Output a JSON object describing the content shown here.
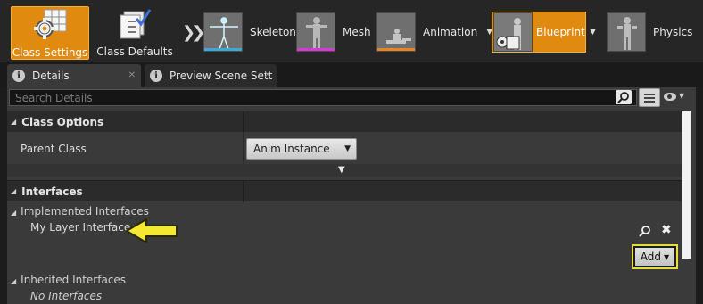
{
  "toolbar": {
    "class_settings_label": "Class Settings",
    "class_defaults_label": "Class Defaults",
    "modes": [
      {
        "label": "Skeleton",
        "accent": "#3fa8d9"
      },
      {
        "label": "Mesh",
        "accent": "#d63ad6"
      },
      {
        "label": "Animation",
        "accent": "#e6842a"
      },
      {
        "label": "Blueprint",
        "accent": "#e08b10"
      },
      {
        "label": "Physics",
        "accent": "#e6d23a"
      }
    ],
    "active_color": "#e08b10"
  },
  "tabs": [
    {
      "label": "Details",
      "icon": "info-icon",
      "active": true
    },
    {
      "label": "Preview Scene Sett",
      "icon": "info-icon",
      "active": false
    }
  ],
  "search": {
    "placeholder": "Search Details"
  },
  "class_options": {
    "title": "Class Options",
    "parent_class_label": "Parent Class",
    "parent_class_value": "Anim Instance"
  },
  "interfaces": {
    "title": "Interfaces",
    "implemented_label": "Implemented Interfaces",
    "implemented_items": [
      "My Layer Interface"
    ],
    "add_label": "Add",
    "inherited_label": "Inherited Interfaces",
    "inherited_empty": "No Interfaces"
  },
  "annotation": {
    "color": "#f5e833",
    "outline": "#2a2a00"
  }
}
